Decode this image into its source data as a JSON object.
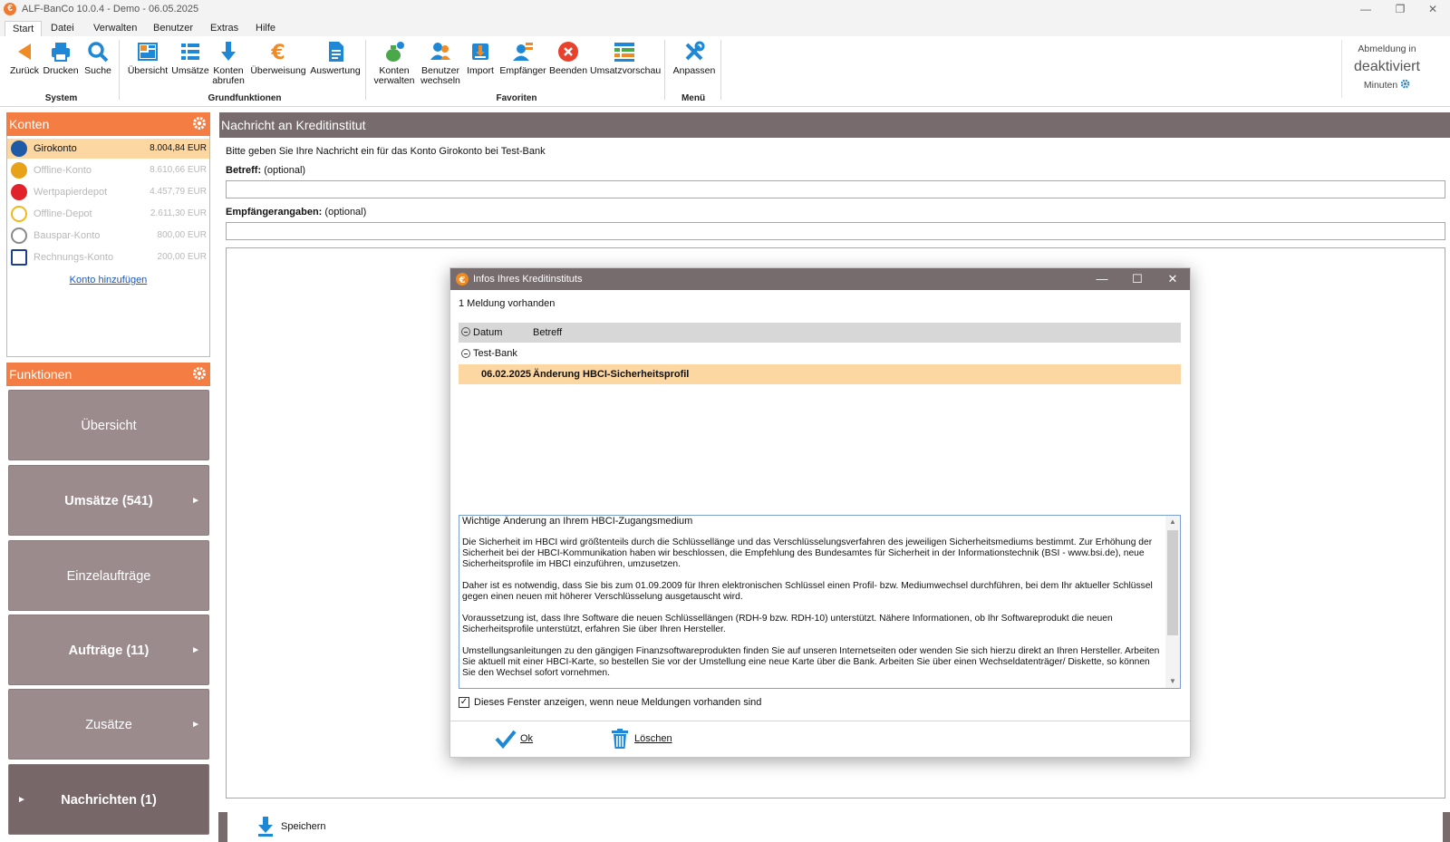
{
  "window": {
    "title": "ALF-BanCo 10.0.4 - Demo  -  06.05.2025",
    "minimize": "—",
    "restore": "❐",
    "close": "✕"
  },
  "menu": {
    "tabs": [
      "Start",
      "Datei",
      "Verwalten",
      "Benutzer",
      "Extras",
      "Hilfe"
    ]
  },
  "ribbon": {
    "groups": {
      "system": "System",
      "grundfunktionen": "Grundfunktionen",
      "favoriten": "Favoriten",
      "menu": "Menü"
    },
    "buttons": {
      "zurueck": "Zurück",
      "drucken": "Drucken",
      "suche": "Suche",
      "uebersicht": "Übersicht",
      "umsaetze": "Umsätze",
      "konten_abrufen_1": "Konten",
      "konten_abrufen_2": "abrufen",
      "ueberweisung": "Überweisung",
      "auswertung": "Auswertung",
      "konten_verwalten_1": "Konten",
      "konten_verwalten_2": "verwalten",
      "benutzer_wechseln_1": "Benutzer",
      "benutzer_wechseln_2": "wechseln",
      "import": "Import",
      "empfaenger": "Empfänger",
      "beenden": "Beenden",
      "umsatzvorschau": "Umsatzvorschau",
      "anpassen": "Anpassen"
    },
    "logout": {
      "label": "Abmeldung in",
      "status": "deaktiviert",
      "unit": "Minuten"
    }
  },
  "sidebar": {
    "konten_title": "Konten",
    "accounts": [
      {
        "name": "Girokonto",
        "balance": "8.004,84 EUR",
        "icon_color": "#1f5aa6"
      },
      {
        "name": "Offline-Konto",
        "balance": "8.610,66 EUR",
        "icon_color": "#e8a21a"
      },
      {
        "name": "Wertpapierdepot",
        "balance": "4.457,79 EUR",
        "icon_color": "#e2222a"
      },
      {
        "name": "Offline-Depot",
        "balance": "2.611,30 EUR",
        "icon_color": "#f2b81b"
      },
      {
        "name": "Bauspar-Konto",
        "balance": "800,00 EUR",
        "icon_color": "#8a8a8a"
      },
      {
        "name": "Rechnungs-Konto",
        "balance": "200,00 EUR",
        "icon_color": "#1c3f94"
      }
    ],
    "add_account": "Konto hinzufügen",
    "funktionen_title": "Funktionen",
    "functions": [
      {
        "label": "Übersicht"
      },
      {
        "label": "Umsätze (541)"
      },
      {
        "label": "Einzelaufträge"
      },
      {
        "label": "Aufträge (11)"
      },
      {
        "label": "Zusätze"
      },
      {
        "label": "Nachrichten (1)"
      }
    ],
    "arrow_right": "►"
  },
  "main": {
    "title": "Nachricht an Kreditinstitut",
    "intro": "Bitte geben Sie Ihre Nachricht ein für das Konto Girokonto bei Test-Bank",
    "betreff_label": "Betreff:",
    "optional": "(optional)",
    "empfaenger_label": "Empfängerangaben:",
    "save": "Speichern"
  },
  "dialog": {
    "title": "Infos Ihres Kreditinstituts",
    "count": "1 Meldung vorhanden",
    "col_datum": "Datum",
    "col_betreff": "Betreff",
    "group": "Test-Bank",
    "row_date": "06.02.2025",
    "row_subject": "Änderung HBCI-Sicherheitsprofil",
    "message": [
      "Wichtige Änderung an Ihrem HBCI-Zugangsmedium",
      "Die Sicherheit im HBCI wird größtenteils durch die Schlüssellänge und das Verschlüsselungsverfahren des jeweiligen Sicherheitsmediums bestimmt. Zur Erhöhung der Sicherheit bei der HBCI-Kommunikation haben wir beschlossen, die Empfehlung des Bundesamtes für Sicherheit in der Informationstechnik (BSI - www.bsi.de), neue Sicherheitsprofile im HBCI einzuführen, umzusetzen.",
      "Daher ist es notwendig, dass Sie bis zum 01.09.2009 für Ihren elektronischen Schlüssel einen Profil- bzw. Mediumwechsel durchführen, bei dem Ihr aktueller Schlüssel gegen einen neuen mit höherer Verschlüsselung ausgetauscht wird.",
      "Voraussetzung ist, dass Ihre Software die neuen Schlüssellängen (RDH-9 bzw. RDH-10) unterstützt. Nähere Informationen, ob Ihr Softwareprodukt die neuen Sicherheitsprofile unterstützt, erfahren Sie über Ihren Hersteller.",
      "Umstellungsanleitungen zu den gängigen Finanzsoftwareprodukten finden Sie auf unseren Internetseiten oder wenden Sie sich hierzu direkt an Ihren Hersteller. Arbeiten Sie aktuell mit einer HBCI-Karte, so bestellen Sie vor der Umstellung eine neue Karte über die Bank. Arbeiten Sie über einen Wechseldatenträger/ Diskette, so können Sie den Wechsel sofort vornehmen."
    ],
    "checkbox_label": "Dieses Fenster anzeigen, wenn neue Meldungen vorhanden sind",
    "checkbox_checked": true,
    "ok": "Ok",
    "delete": "Löschen",
    "minimize": "—",
    "maximize": "☐",
    "close": "✕"
  },
  "colors": {
    "accent_orange": "#f47d44",
    "header_taupe": "#776b6d",
    "function_button": "#9b8b8d",
    "selection": "#fdd7a2",
    "icon_blue": "#1e88d6"
  }
}
